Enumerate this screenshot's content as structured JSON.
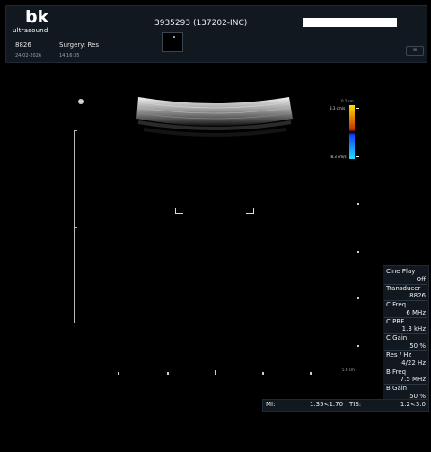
{
  "header": {
    "logo_mark": "bk",
    "logo_sub": "ultrasound",
    "patient_id": "3935293 (137202-INC)",
    "exam_number": "8826",
    "exam_type": "Surgery: Res",
    "exam_date": "24-02-2026",
    "exam_time": "14:16:35",
    "corner_button": "⊞"
  },
  "color_bar": {
    "top_label": "0.2 cm",
    "high_label": "8.3 cm/s",
    "low_label": "-8.3 cm/s",
    "depth_label": "5.6 cm",
    "colors": {
      "top": "#ffe000",
      "upper": "#c83000",
      "lower": "#1040ff",
      "bottom": "#20e0ff"
    }
  },
  "panel": {
    "items": [
      {
        "label": "Cine Play",
        "value": "Off"
      },
      {
        "label": "Transducer",
        "value": "8826"
      },
      {
        "label": "C Freq",
        "value": "6 MHz"
      },
      {
        "label": "C PRF",
        "value": "1.3 kHz"
      },
      {
        "label": "C Gain",
        "value": "50 %"
      },
      {
        "label": "Res / Hz",
        "value": "4/22 Hz"
      },
      {
        "label": "B Freq",
        "value": "7.5 MHz"
      },
      {
        "label": "B Gain",
        "value": "50 %"
      }
    ]
  },
  "status": {
    "mi_label": "MI:",
    "mi_value": "1.35<1.70",
    "tis_label": "TIS:",
    "tis_value": "1.2<3.0"
  }
}
